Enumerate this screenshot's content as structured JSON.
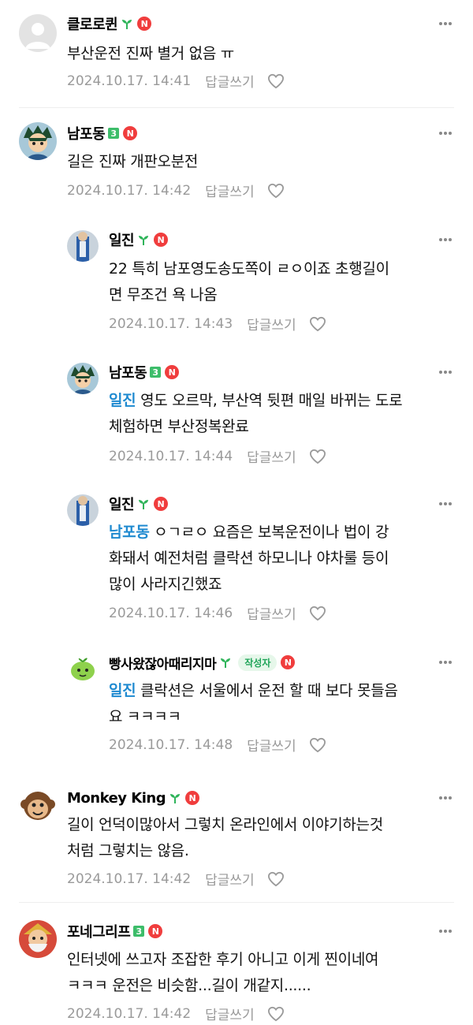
{
  "comments": [
    {
      "nick": "클로로퀸",
      "body": "부산운전 진짜 별거 없음 ㅠ",
      "time": "2024.10.17. 14:41",
      "reply": "답글쓰기"
    },
    {
      "nick": "남포동",
      "level": "3",
      "body": "길은 진짜 개판오분전",
      "time": "2024.10.17. 14:42",
      "reply": "답글쓰기"
    },
    {
      "nick": "일진",
      "body_l1": "22 특히 남포영도송도쪽이 ㄹㅇ이죠 초행길이",
      "body_l2": "면 무조건 욕 나옴",
      "time": "2024.10.17. 14:43",
      "reply": "답글쓰기"
    },
    {
      "nick": "남포동",
      "level": "3",
      "mention": "일진",
      "body_l1": " 영도 오르막, 부산역 뒷편 매일 바뀌는 도로",
      "body_l2": "체험하면 부산정복완료",
      "time": "2024.10.17. 14:44",
      "reply": "답글쓰기"
    },
    {
      "nick": "일진",
      "mention": "남포동",
      "body_l1": " ㅇㄱㄹㅇ 요즘은 보복운전이나 법이 강",
      "body_l2": "화돼서 예전처럼 클락션 하모니나 야차룰 등이",
      "body_l3": "많이 사라지긴했죠",
      "time": "2024.10.17. 14:46",
      "reply": "답글쓰기"
    },
    {
      "nick": "빵사왔잖아때리지마",
      "author_tag": "작성자",
      "mention": "일진",
      "body_l1": " 클락션은 서울에서 운전 할 때 보다 못들음",
      "body_l2": "요 ㅋㅋㅋㅋ",
      "time": "2024.10.17. 14:48",
      "reply": "답글쓰기"
    },
    {
      "nick": "Monkey King",
      "body_l1": "길이 언덕이많아서 그렇치 온라인에서 이야기하는것",
      "body_l2": "처럼 그렇치는 않음.",
      "time": "2024.10.17. 14:42",
      "reply": "답글쓰기"
    },
    {
      "nick": "포네그리프",
      "level": "3",
      "body_l1": "인터넷에 쓰고자 조잡한 후기 아니고 이게 찐이네여",
      "body_l2": "ㅋㅋㅋ 운전은 비슷함...길이 개같지......",
      "time": "2024.10.17. 14:42",
      "reply": "답글쓰기"
    }
  ],
  "badges": {
    "n_badge": "N"
  },
  "colors": {
    "mention": "#1f8ad0",
    "level_badge": "#3dbd6a",
    "n_badge": "#f03d3d",
    "meta": "#9a9a9a"
  },
  "icons": {
    "more": "more-vertical-icon",
    "sprout": "sprout-icon",
    "heart": "heart-outline-icon"
  }
}
